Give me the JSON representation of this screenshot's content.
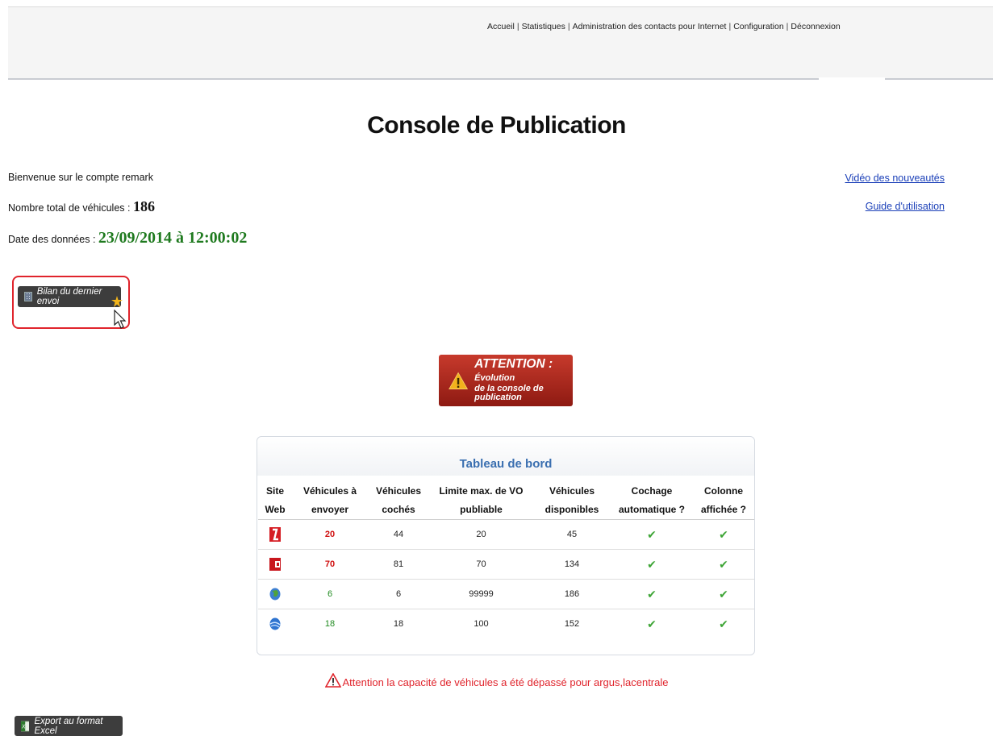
{
  "nav": {
    "items": [
      "Accueil",
      "Statistiques",
      "Administration des contacts pour Internet",
      "Configuration",
      "Déconnexion"
    ],
    "separator": "|"
  },
  "page": {
    "title": "Console de Publication"
  },
  "info": {
    "welcome": "Bienvenue sur le compte remark",
    "total_label": "Nombre total de véhicules : ",
    "total_value": "186",
    "date_label": "Date des données : ",
    "date_value": "23/09/2014 à 12:00:02"
  },
  "links": {
    "video": "Vidéo des nouveautés",
    "guide": "Guide d'utilisation"
  },
  "buttons": {
    "bilan": "Bilan du dernier envoi",
    "export": "Export au format Excel"
  },
  "attention_banner": {
    "bold": "ATTENTION :",
    "line1_rest": "Évolution",
    "line2": "de la console de publication"
  },
  "dashboard": {
    "title": "Tableau de bord",
    "columns": [
      [
        "Site",
        "Web"
      ],
      [
        "Véhicules à",
        "envoyer"
      ],
      [
        "Véhicules",
        "cochés"
      ],
      [
        "Limite max. de VO",
        "publiable"
      ],
      [
        "Véhicules",
        "disponibles"
      ],
      [
        "Cochage",
        "automatique ?"
      ],
      [
        "Colonne",
        "affichée ?"
      ]
    ],
    "rows": [
      {
        "site_icon": "argus-logo-icon",
        "to_send": "20",
        "to_send_status": "over",
        "checked": "44",
        "limit": "20",
        "available": "45",
        "auto_check": "✔",
        "column_shown": "✔"
      },
      {
        "site_icon": "lacentrale-logo-icon",
        "to_send": "70",
        "to_send_status": "over",
        "checked": "81",
        "limit": "70",
        "available": "134",
        "auto_check": "✔",
        "column_shown": "✔"
      },
      {
        "site_icon": "globe-icon",
        "to_send": "6",
        "to_send_status": "ok",
        "checked": "6",
        "limit": "99999",
        "available": "186",
        "auto_check": "✔",
        "column_shown": "✔"
      },
      {
        "site_icon": "blue-sphere-icon",
        "to_send": "18",
        "to_send_status": "ok",
        "checked": "18",
        "limit": "100",
        "available": "152",
        "auto_check": "✔",
        "column_shown": "✔"
      }
    ]
  },
  "warning": {
    "text": "Attention la capacité de véhicules a été dépassé pour argus,lacentrale",
    "icon": "warning-triangle-icon"
  },
  "colors": {
    "over": "#d01010",
    "ok": "#1f8a1f",
    "accent": "#3a6fb0",
    "banner": "#a8261b"
  }
}
